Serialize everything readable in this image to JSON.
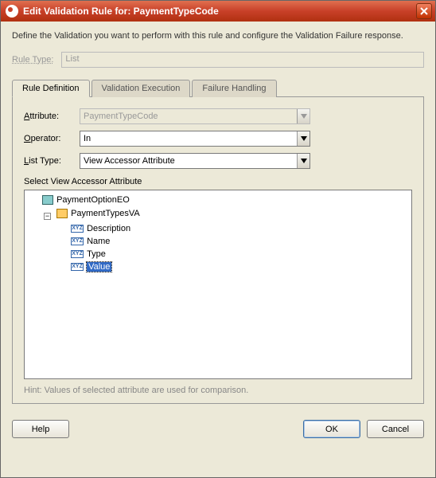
{
  "window": {
    "title": "Edit Validation Rule for: PaymentTypeCode"
  },
  "description": "Define the Validation you want to perform with this rule and configure the Validation Failure response.",
  "ruleType": {
    "label": "Rule Type:",
    "value": "List"
  },
  "tabs": {
    "definition": "Rule Definition",
    "execution": "Validation Execution",
    "failure": "Failure Handling"
  },
  "fields": {
    "attribute": {
      "label": "Attribute:",
      "value": "PaymentTypeCode"
    },
    "operator": {
      "label": "Operator:",
      "value": "In"
    },
    "listType": {
      "label": "List Type:",
      "value": "View Accessor Attribute"
    }
  },
  "selectSection": {
    "label": "Select View Accessor Attribute"
  },
  "tree": {
    "root": {
      "label": "PaymentOptionEO",
      "children": [
        {
          "label": "PaymentTypesVA",
          "children": [
            {
              "label": "Description"
            },
            {
              "label": "Name"
            },
            {
              "label": "Type"
            },
            {
              "label": "Value",
              "selected": true
            }
          ]
        }
      ]
    }
  },
  "hint": "Hint: Values of selected attribute are used for comparison.",
  "buttons": {
    "help": "Help",
    "ok": "OK",
    "cancel": "Cancel"
  }
}
